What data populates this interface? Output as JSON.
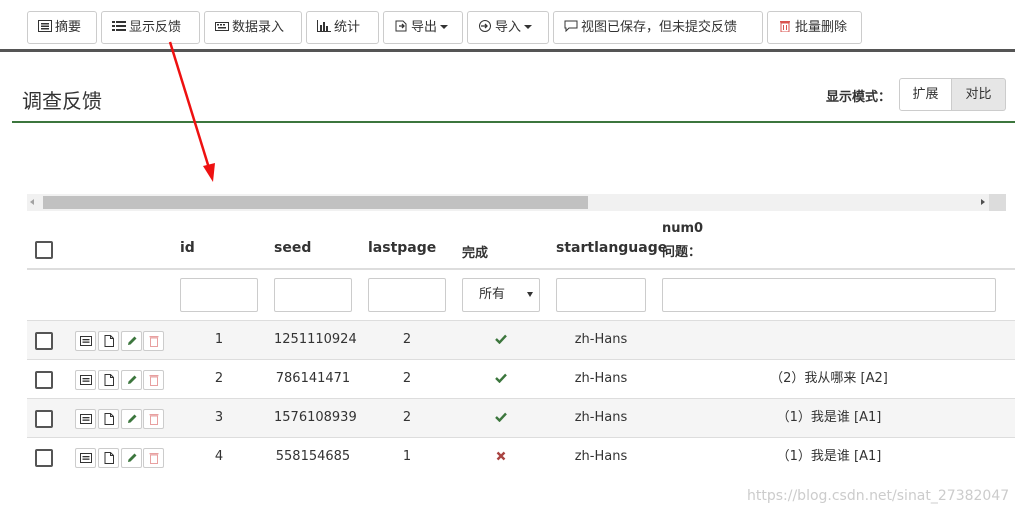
{
  "toolbar": {
    "summary": "摘要",
    "show_feedback": "显示反馈",
    "data_entry": "数据录入",
    "stats": "统计",
    "export": "导出",
    "import": "导入",
    "view_saved": "视图已保存，但未提交反馈",
    "bulk_delete": "批量删除"
  },
  "page": {
    "title": "调查反馈",
    "mode_label": "显示模式：",
    "mode_expand": "扩展",
    "mode_compare": "对比"
  },
  "table": {
    "headers": {
      "id": "id",
      "seed": "seed",
      "lastpage": "lastpage",
      "done": "完成",
      "startlanguage": "startlanguage",
      "num0_line1": "num0",
      "num0_line2": "问题："
    },
    "filter_done": "所有",
    "rows": [
      {
        "id": "1",
        "seed": "1251110924",
        "lastpage": "2",
        "done": "yes",
        "lang": "zh-Hans",
        "answer": ""
      },
      {
        "id": "2",
        "seed": "786141471",
        "lastpage": "2",
        "done": "yes",
        "lang": "zh-Hans",
        "answer": "（2）我从哪来 [A2]"
      },
      {
        "id": "3",
        "seed": "1576108939",
        "lastpage": "2",
        "done": "yes",
        "lang": "zh-Hans",
        "answer": "（1）我是谁 [A1]"
      },
      {
        "id": "4",
        "seed": "558154685",
        "lastpage": "1",
        "done": "no",
        "lang": "zh-Hans",
        "answer": "（1）我是谁 [A1]"
      }
    ]
  },
  "colors": {
    "check": "#3c763d",
    "cross": "#a94442",
    "accent": "#3c763d"
  },
  "watermark": "https://blog.csdn.net/sinat_27382047"
}
